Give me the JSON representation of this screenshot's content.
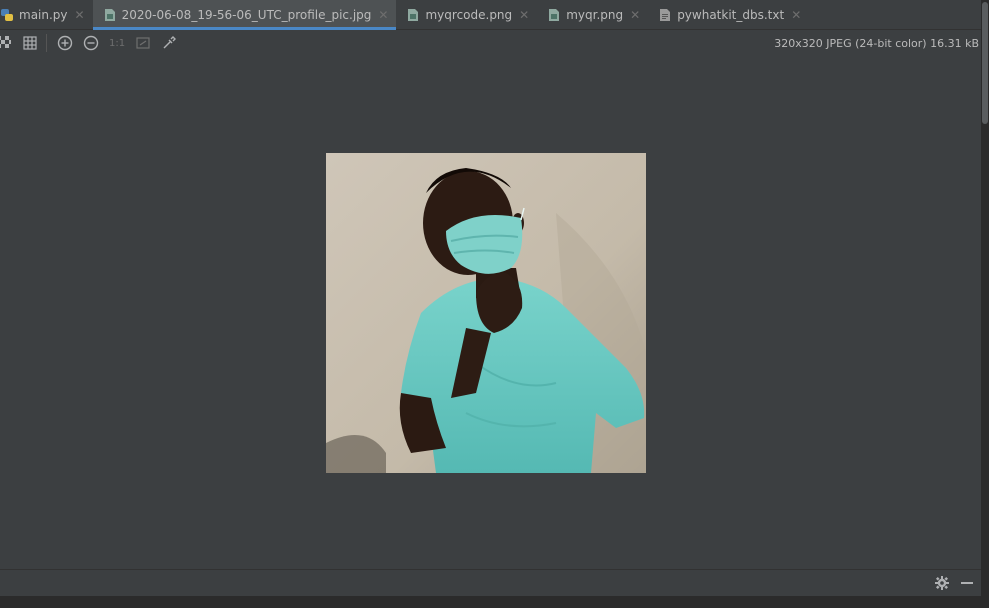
{
  "tabs": [
    {
      "label": "main.py",
      "icon": "python-file-icon",
      "active": false
    },
    {
      "label": "2020-06-08_19-56-06_UTC_profile_pic.jpg",
      "icon": "image-file-icon",
      "active": true
    },
    {
      "label": "myqrcode.png",
      "icon": "image-file-icon",
      "active": false
    },
    {
      "label": "myqr.png",
      "icon": "image-file-icon",
      "active": false
    },
    {
      "label": "pywhatkit_dbs.txt",
      "icon": "text-file-icon",
      "active": false
    }
  ],
  "toolbar": {
    "actual_size_label": "1:1",
    "icons": [
      "chessboard-icon",
      "grid-icon",
      "zoom-in-icon",
      "zoom-out-icon",
      "actual-size-icon",
      "fit-icon",
      "color-picker-icon"
    ]
  },
  "image_info": "320x320 JPEG (24-bit color) 16.31 kB",
  "colors": {
    "accent": "#4a88c7",
    "background": "#3c3f41",
    "shirt": "#5fc7c0",
    "mask": "#78d0c8",
    "wall": "#c9bfb0"
  }
}
